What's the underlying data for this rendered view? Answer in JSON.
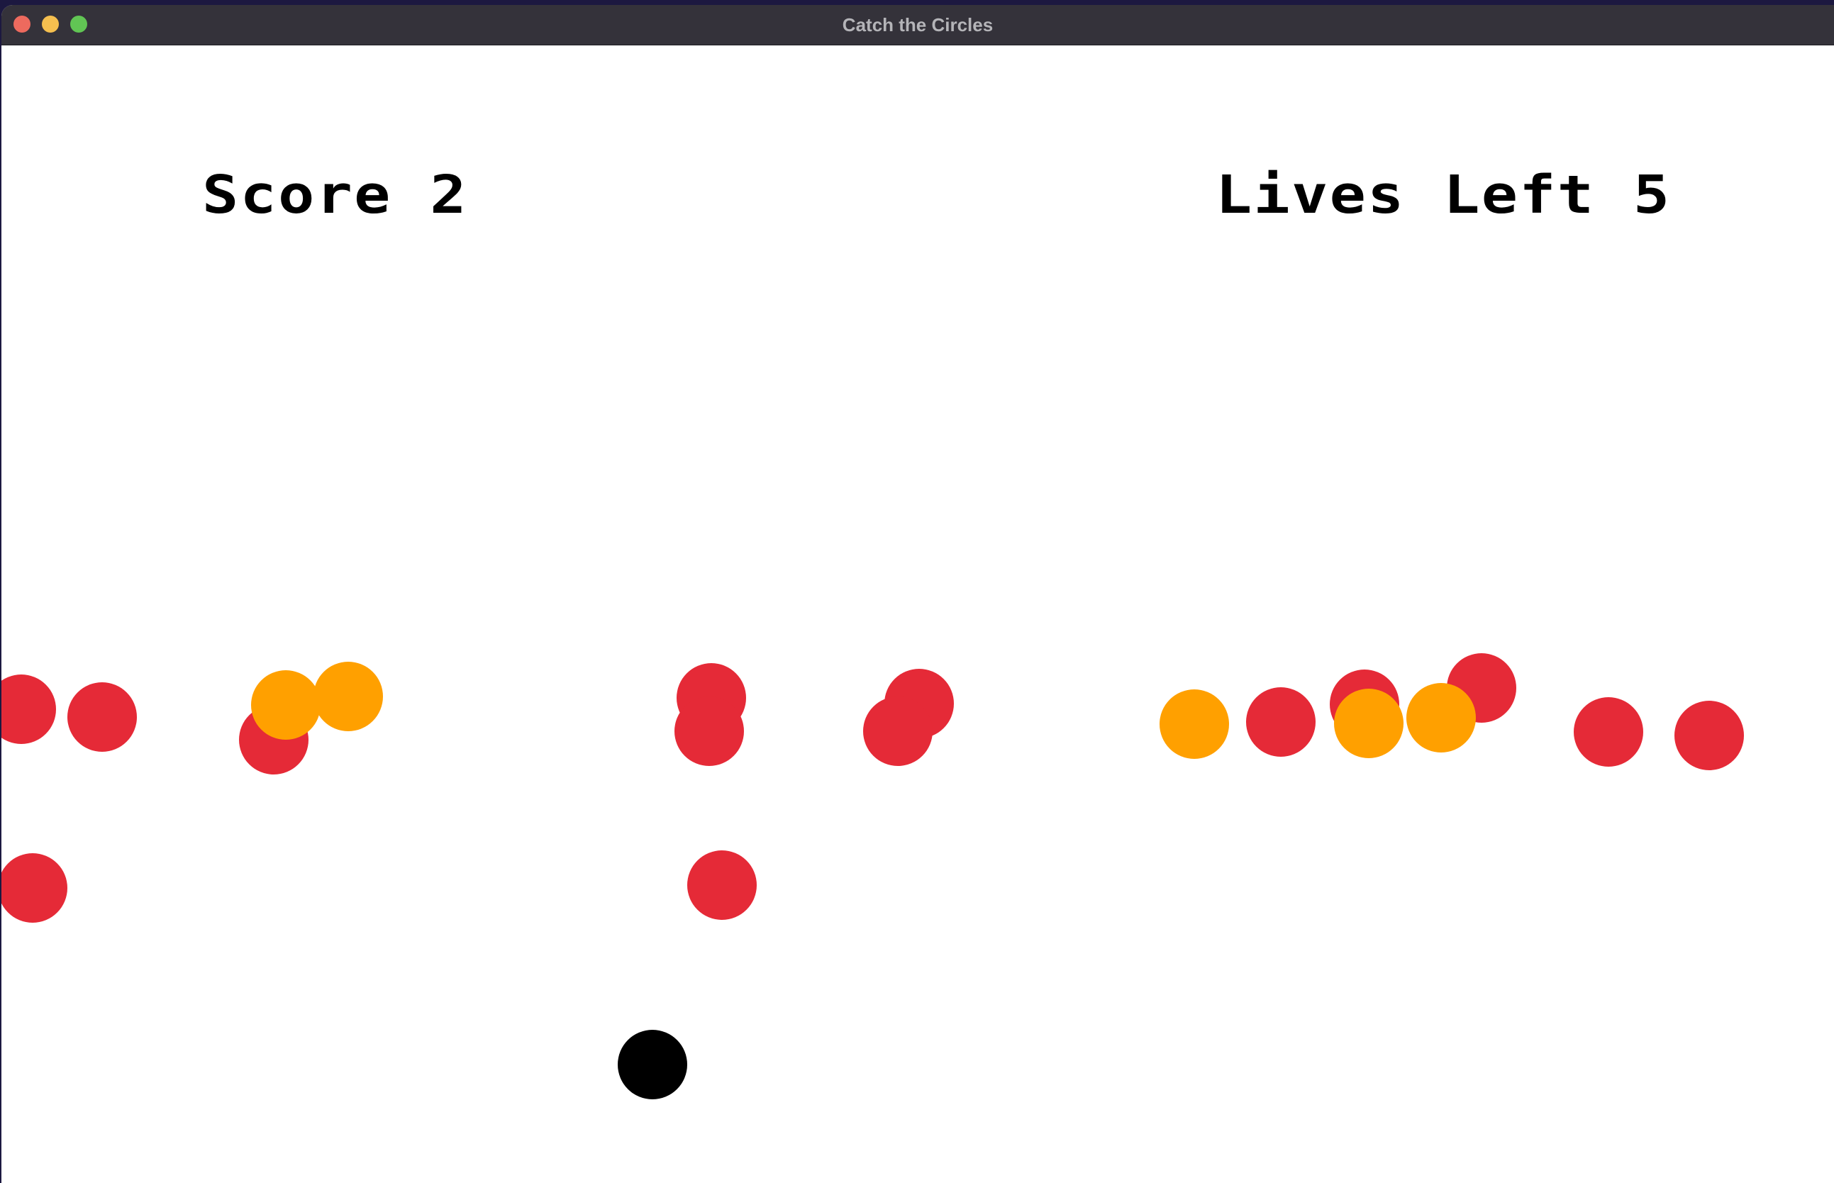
{
  "window": {
    "title": "Catch the Circles"
  },
  "hud": {
    "score_label": "Score 2",
    "lives_label": "Lives Left 5"
  },
  "colors": {
    "red_circle": "#e52a37",
    "orange_circle": "#ffa000",
    "player": "#000000",
    "background": "#ffffff"
  },
  "icons": {
    "close": "close-icon",
    "minimize": "minimize-icon",
    "maximize": "maximize-icon"
  }
}
